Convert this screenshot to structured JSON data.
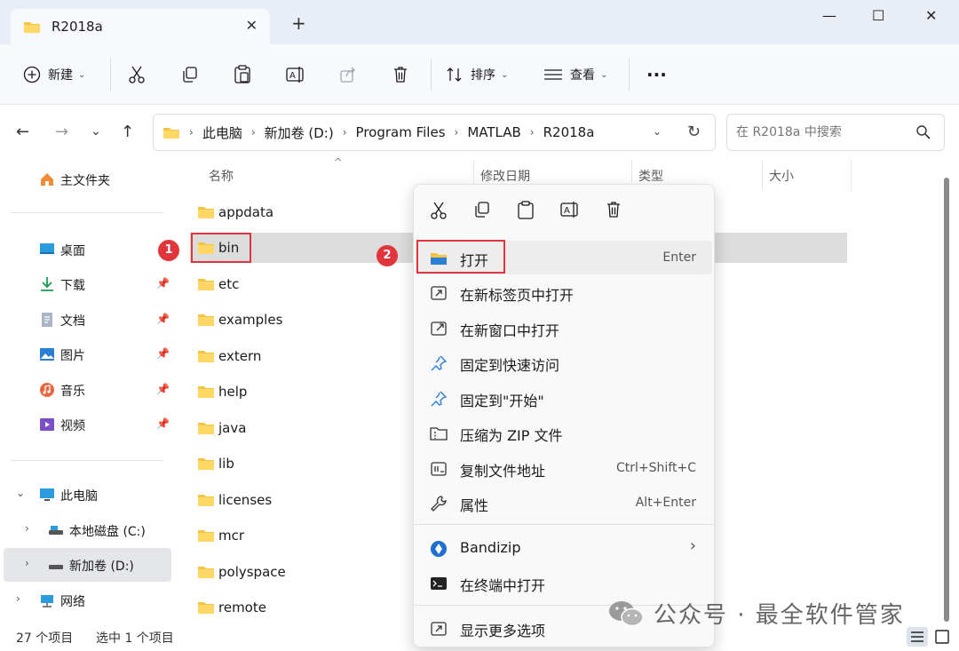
{
  "window": {
    "tab_title": "R2018a",
    "tab_close": "✕",
    "new_tab": "+",
    "minimize": "—",
    "maximize": "☐",
    "close": "✕"
  },
  "toolbar": {
    "new_label": "新建",
    "sort_label": "排序",
    "view_label": "查看",
    "more_label": "···"
  },
  "address": {
    "crumbs": [
      "此电脑",
      "新加卷 (D:)",
      "Program Files",
      "MATLAB",
      "R2018a"
    ],
    "search_placeholder": "在 R2018a 中搜索"
  },
  "sidebar": {
    "home": "主文件夹",
    "quick": [
      {
        "label": "桌面",
        "icon": "desktop-icon"
      },
      {
        "label": "下载",
        "icon": "download-icon"
      },
      {
        "label": "文档",
        "icon": "document-icon"
      },
      {
        "label": "图片",
        "icon": "pictures-icon"
      },
      {
        "label": "音乐",
        "icon": "music-icon"
      },
      {
        "label": "视频",
        "icon": "video-icon"
      }
    ],
    "this_pc": "此电脑",
    "drive_c": "本地磁盘 (C:)",
    "drive_d": "新加卷 (D:)",
    "network": "网络"
  },
  "columns": {
    "name": "名称",
    "modified": "修改日期",
    "type": "类型",
    "size": "大小"
  },
  "files": [
    "appdata",
    "bin",
    "etc",
    "examples",
    "extern",
    "help",
    "java",
    "lib",
    "licenses",
    "mcr",
    "polyspace",
    "remote"
  ],
  "selected_file": "bin",
  "annotations": {
    "step1": "1",
    "step2": "2"
  },
  "context_menu": {
    "items": [
      {
        "label": "打开",
        "shortcut": "Enter",
        "icon": "folder-open-icon"
      },
      {
        "label": "在新标签页中打开",
        "shortcut": "",
        "icon": "open-new-tab-icon"
      },
      {
        "label": "在新窗口中打开",
        "shortcut": "",
        "icon": "open-new-window-icon"
      },
      {
        "label": "固定到快速访问",
        "shortcut": "",
        "icon": "pin-icon"
      },
      {
        "label": "固定到\"开始\"",
        "shortcut": "",
        "icon": "pin-start-icon"
      },
      {
        "label": "压缩为 ZIP 文件",
        "shortcut": "",
        "icon": "zip-icon"
      },
      {
        "label": "复制文件地址",
        "shortcut": "Ctrl+Shift+C",
        "icon": "copy-path-icon"
      },
      {
        "label": "属性",
        "shortcut": "Alt+Enter",
        "icon": "properties-icon"
      },
      {
        "label": "Bandizip",
        "shortcut": "",
        "icon": "bandizip-icon"
      },
      {
        "label": "在终端中打开",
        "shortcut": "",
        "icon": "terminal-icon"
      },
      {
        "label": "显示更多选项",
        "shortcut": "",
        "icon": "more-options-icon"
      }
    ],
    "submenu_arrow": "›"
  },
  "status": {
    "count": "27 个项目",
    "selected": "选中 1 个项目"
  },
  "watermark": "公众号 · 最全软件管家"
}
